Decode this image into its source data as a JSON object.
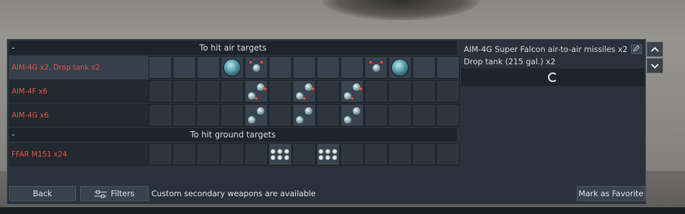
{
  "air_header": {
    "dash": "-",
    "title": "To hit air targets"
  },
  "ground_header": {
    "dash": "-",
    "title": "To hit ground targets"
  },
  "rows": [
    {
      "label": "AIM-4G x2,  Drop tank x2"
    },
    {
      "label": "AIM-4F x6"
    },
    {
      "label": "AIM-4G x6"
    },
    {
      "label": "FFAR M151 x24"
    }
  ],
  "info": {
    "line1": "AIM-4G Super Falcon air-to-air missiles x2",
    "line2": "Drop tank (215 gal.) x2"
  },
  "buttons": {
    "back": "Back",
    "filters": "Filters",
    "favorite": "Mark as Favorite"
  },
  "notice": "Custom secondary weapons are available",
  "icons": {
    "edit": "pencil-icon",
    "scroll_up": "chevron-up-icon",
    "scroll_down": "chevron-down-icon",
    "filters": "sliders-icon",
    "loading": "spinner-icon"
  },
  "colors": {
    "preset_label": "#e05445",
    "panel": "#2b313a",
    "header": "#1f242c"
  }
}
